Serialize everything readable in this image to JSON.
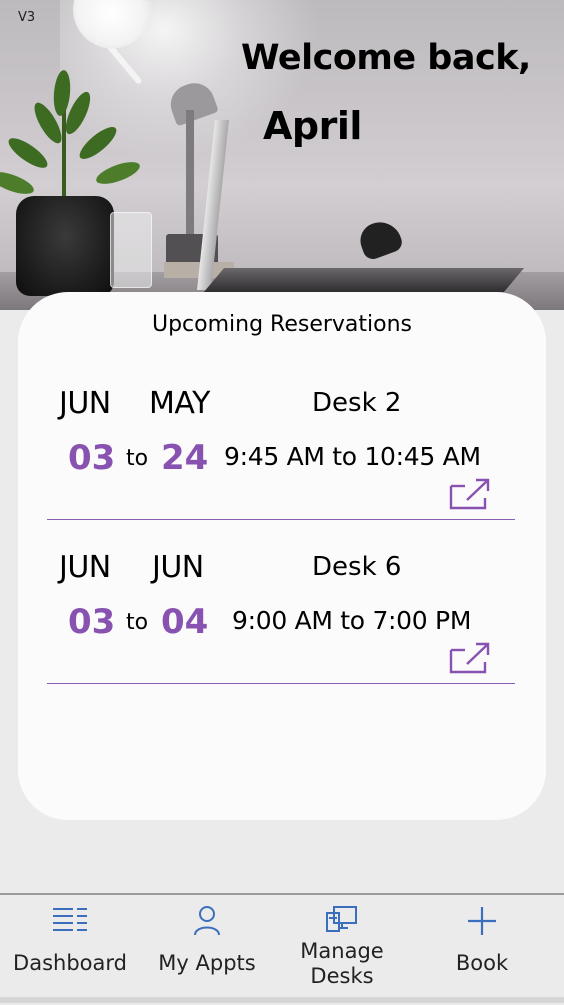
{
  "app": {
    "version": "V3"
  },
  "header": {
    "welcome": "Welcome back,",
    "user_name": "April"
  },
  "reservations": {
    "title": "Upcoming Reservations",
    "items": [
      {
        "start_month": "JUN",
        "end_month": "MAY",
        "start_day": "03",
        "end_day": "24",
        "to": "to",
        "desk": "Desk 2",
        "time": "9:45 AM to 10:45 AM",
        "action_icon": "open-external-icon"
      },
      {
        "start_month": "JUN",
        "end_month": "JUN",
        "start_day": "03",
        "end_day": "04",
        "to": "to",
        "desk": "Desk 6",
        "time": "9:00 AM to 7:00 PM",
        "action_icon": "open-external-icon"
      }
    ]
  },
  "nav": {
    "items": [
      {
        "label": "Dashboard",
        "icon": "list-icon"
      },
      {
        "label": "My Appts",
        "icon": "person-icon"
      },
      {
        "label_line1": "Manage",
        "label_line2": "Desks",
        "icon": "desk-monitor-icon"
      },
      {
        "label": "Book",
        "icon": "plus-icon"
      }
    ]
  },
  "colors": {
    "accent": "#8852b0",
    "nav_icon": "#3b6fbd",
    "card_bg": "#fcfbfc",
    "page_bg": "#ebebeb"
  }
}
